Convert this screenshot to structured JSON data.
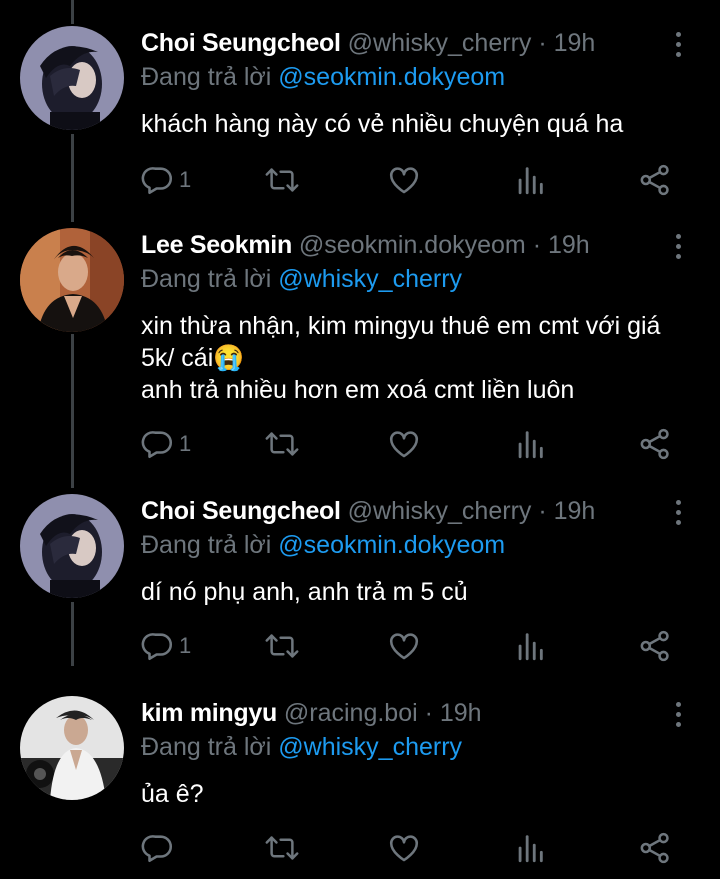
{
  "colors": {
    "background": "#000000",
    "text": "#ffffff",
    "muted": "#6e767d",
    "mention": "#1d9bf0",
    "thread_line": "#3c4145"
  },
  "icons": {
    "reply": "reply-icon",
    "retweet": "retweet-icon",
    "like": "heart-icon",
    "views": "views-icon",
    "share": "share-icon",
    "more": "more-dots-icon"
  },
  "tweets": [
    {
      "name": "Choi Seungcheol",
      "handle": "@whisky_cherry",
      "sep": " · ",
      "time": "19h",
      "reply_prefix": "Đang trả lời ",
      "reply_mention": "@seokmin.dokyeom",
      "text": "khách hàng này có vẻ nhiều chuyện quá ha",
      "reply_count": "1"
    },
    {
      "name": "Lee Seokmin",
      "handle": "@seokmin.dokyeom",
      "sep": " · ",
      "time": "19h",
      "reply_prefix": "Đang trả lời ",
      "reply_mention": "@whisky_cherry",
      "text": "xin thừa nhận, kim mingyu thuê em cmt với giá 5k/ cái😭\nanh trả nhiều hơn em xoá cmt liền luôn",
      "reply_count": "1"
    },
    {
      "name": "Choi Seungcheol",
      "handle": "@whisky_cherry",
      "sep": " · ",
      "time": "19h",
      "reply_prefix": "Đang trả lời ",
      "reply_mention": "@seokmin.dokyeom",
      "text": "dí nó phụ anh, anh trả m 5 củ",
      "reply_count": "1"
    },
    {
      "name": "kim mingyu",
      "handle": "@racing.boi",
      "sep": " · ",
      "time": "19h",
      "reply_prefix": "Đang trả lời ",
      "reply_mention": "@whisky_cherry",
      "text": "ủa ê?",
      "reply_count": ""
    }
  ]
}
